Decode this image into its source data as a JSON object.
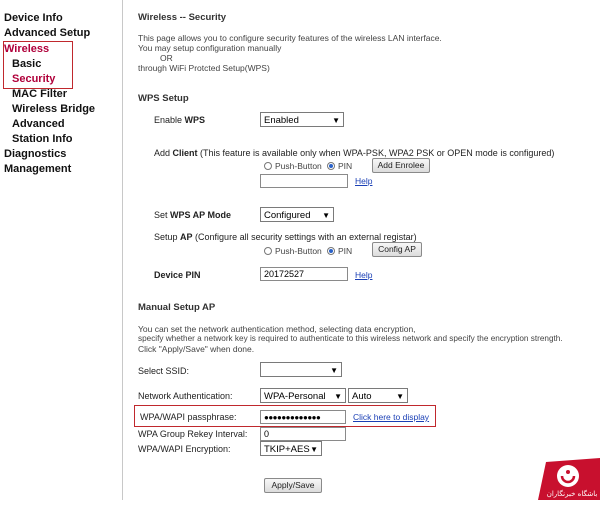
{
  "sidebar": {
    "items": [
      {
        "label": "Device Info"
      },
      {
        "label": "Advanced Setup"
      },
      {
        "label": "Wireless"
      },
      {
        "label": "Basic"
      },
      {
        "label": "Security"
      },
      {
        "label": "MAC Filter"
      },
      {
        "label": "Wireless Bridge"
      },
      {
        "label": "Advanced"
      },
      {
        "label": "Station Info"
      },
      {
        "label": "Diagnostics"
      },
      {
        "label": "Management"
      }
    ]
  },
  "page": {
    "title": "Wireless -- Security",
    "intro1": "This page allows you to configure security features of the wireless LAN interface.",
    "intro2": "You may setup configuration manually",
    "intro3": "OR",
    "intro4": "through WiFi Protcted Setup(WPS)"
  },
  "wps": {
    "heading": "WPS Setup",
    "enable_label_pre": "Enable ",
    "enable_label_bold": "WPS",
    "enable_value": "Enabled",
    "add_client_pre": "Add ",
    "add_client_bold": "Client",
    "add_client_note": " (This feature is available only when WPA-PSK, WPA2 PSK or OPEN mode is configured)",
    "push_button_label": "Push-Button",
    "pin_label": "PIN",
    "add_enrolee_label": "Add Enrolee",
    "help_label": "Help",
    "ap_mode_pre": "Set ",
    "ap_mode_bold": "WPS AP Mode",
    "ap_mode_value": "Configured",
    "setup_ap_pre": "Setup ",
    "setup_ap_bold": "AP",
    "setup_ap_note": " (Configure all security settings with an external registar)",
    "push_button_label2": "Push-Button",
    "pin_label2": "PIN",
    "config_ap_label": "Config AP",
    "device_pin_label": "Device PIN",
    "device_pin_value": "20172527",
    "help_label2": "Help"
  },
  "manual": {
    "heading": "Manual Setup AP",
    "desc1": "You can set the network authentication method, selecting data encryption,",
    "desc2": "specify whether a network key is required to authenticate to this wireless network and specify the encryption strength.",
    "desc3": "Click \"Apply/Save\" when done.",
    "ssid_label": "Select SSID:",
    "ssid_value": "",
    "auth_label": "Network Authentication:",
    "auth_value": "WPA-Personal",
    "auth_mode_value": "Auto",
    "pass_label": "WPA/WAPI passphrase:",
    "pass_value": "●●●●●●●●●●●●●",
    "display_link": "Click here to display",
    "rekey_label": "WPA Group Rekey Interval:",
    "rekey_value": "0",
    "enc_label": "WPA/WAPI Encryption:",
    "enc_value": "TKIP+AES",
    "apply_label": "Apply/Save"
  },
  "watermark": {
    "text": "باشگاه خبرنگاران"
  },
  "colors": {
    "accent": "#b0003a",
    "highlight_border": "#c0282d",
    "link": "#1a3fb5",
    "logo_red": "#c8102e"
  }
}
